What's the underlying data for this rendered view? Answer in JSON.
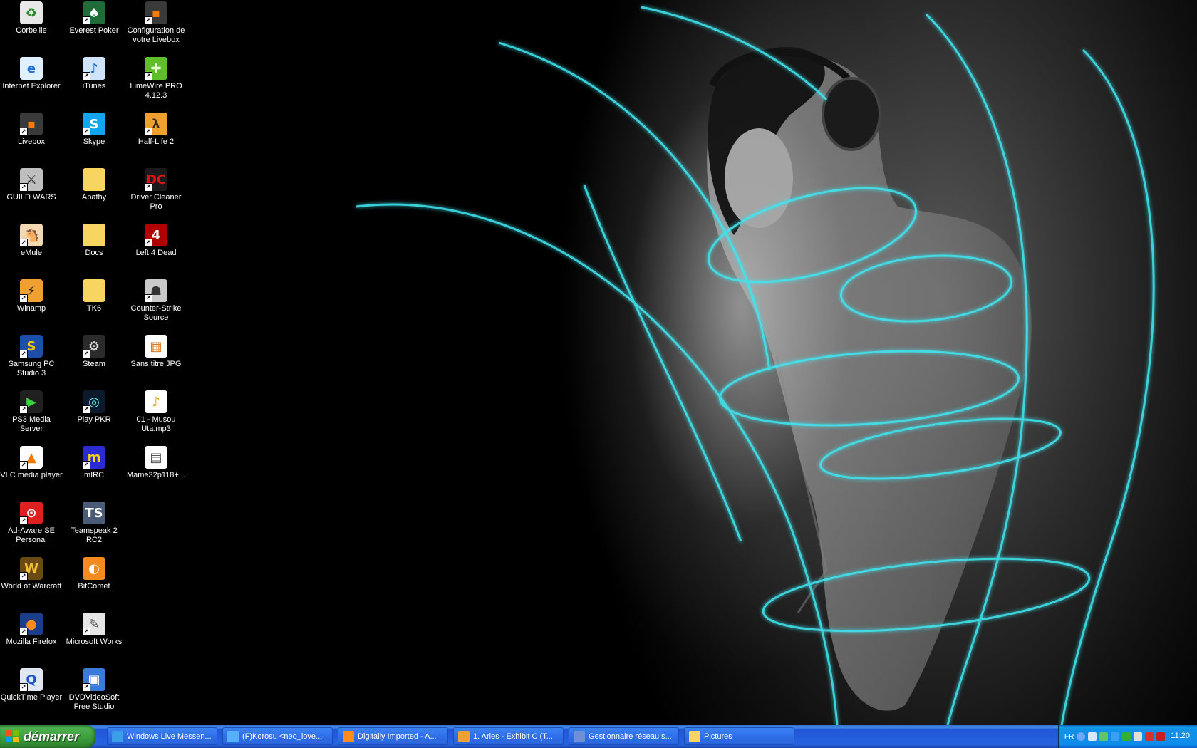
{
  "desktop": {
    "icons": [
      {
        "label": "Corbeille",
        "col": 0,
        "row": 0,
        "glyph": "♻",
        "bg": "#e8e8e8",
        "fg": "#2a8a2a",
        "shortcut": false,
        "name": "recycle-bin-icon"
      },
      {
        "label": "Internet Explorer",
        "col": 0,
        "row": 1,
        "glyph": "e",
        "bg": "#dff0ff",
        "fg": "#1c6ed6",
        "shortcut": false,
        "name": "internet-explorer-icon"
      },
      {
        "label": "Livebox",
        "col": 0,
        "row": 2,
        "glyph": "▪",
        "bg": "#3a3a3a",
        "fg": "#ff7a00",
        "shortcut": true,
        "name": "livebox-icon"
      },
      {
        "label": "GUILD WARS",
        "col": 0,
        "row": 3,
        "glyph": "⚔",
        "bg": "#bfbfbf",
        "fg": "#333",
        "shortcut": true,
        "name": "guild-wars-icon"
      },
      {
        "label": "eMule",
        "col": 0,
        "row": 4,
        "glyph": "🐴",
        "bg": "#f3d9b3",
        "fg": "#8b4513",
        "shortcut": true,
        "name": "emule-icon"
      },
      {
        "label": "Winamp",
        "col": 0,
        "row": 5,
        "glyph": "⚡",
        "bg": "#f0a030",
        "fg": "#222",
        "shortcut": true,
        "name": "winamp-icon"
      },
      {
        "label": "Samsung PC Studio 3",
        "col": 0,
        "row": 6,
        "glyph": "S",
        "bg": "#1d4fa8",
        "fg": "#ffcc00",
        "shortcut": true,
        "name": "samsung-pc-studio-icon"
      },
      {
        "label": "PS3 Media Server",
        "col": 0,
        "row": 7,
        "glyph": "▶",
        "bg": "#202020",
        "fg": "#3ecf3e",
        "shortcut": true,
        "name": "ps3-media-server-icon"
      },
      {
        "label": "VLC media player",
        "col": 0,
        "row": 8,
        "glyph": "▲",
        "bg": "#ffffff",
        "fg": "#f07800",
        "shortcut": true,
        "name": "vlc-icon"
      },
      {
        "label": "Ad-Aware SE Personal",
        "col": 0,
        "row": 9,
        "glyph": "⊙",
        "bg": "#e02020",
        "fg": "#fff",
        "shortcut": true,
        "name": "ad-aware-icon"
      },
      {
        "label": "World of Warcraft",
        "col": 0,
        "row": 10,
        "glyph": "W",
        "bg": "#6b4a14",
        "fg": "#f1c232",
        "shortcut": true,
        "name": "world-of-warcraft-icon"
      },
      {
        "label": "Mozilla Firefox",
        "col": 0,
        "row": 11,
        "glyph": "●",
        "bg": "#1c3e8a",
        "fg": "#ff8c1a",
        "shortcut": true,
        "name": "firefox-icon"
      },
      {
        "label": "QuickTime Player",
        "col": 0,
        "row": 12,
        "glyph": "Q",
        "bg": "#dfe8f3",
        "fg": "#1a56c0",
        "shortcut": true,
        "name": "quicktime-icon"
      },
      {
        "label": "Everest Poker",
        "col": 1,
        "row": 0,
        "glyph": "♠",
        "bg": "#1f6b3a",
        "fg": "#fff",
        "shortcut": true,
        "name": "everest-poker-icon"
      },
      {
        "label": "iTunes",
        "col": 1,
        "row": 1,
        "glyph": "♪",
        "bg": "#cfe4fb",
        "fg": "#1c6ed6",
        "shortcut": true,
        "name": "itunes-icon"
      },
      {
        "label": "Skype",
        "col": 1,
        "row": 2,
        "glyph": "S",
        "bg": "#12a5f0",
        "fg": "#fff",
        "shortcut": true,
        "name": "skype-icon"
      },
      {
        "label": "Apathy",
        "col": 1,
        "row": 3,
        "glyph": "",
        "bg": "#f7d560",
        "fg": "#c9a227",
        "shortcut": false,
        "name": "folder-icon"
      },
      {
        "label": "Docs",
        "col": 1,
        "row": 4,
        "glyph": "",
        "bg": "#f7d560",
        "fg": "#c9a227",
        "shortcut": false,
        "name": "folder-icon"
      },
      {
        "label": "TK6",
        "col": 1,
        "row": 5,
        "glyph": "",
        "bg": "#f7d560",
        "fg": "#c9a227",
        "shortcut": false,
        "name": "folder-icon"
      },
      {
        "label": "Steam",
        "col": 1,
        "row": 6,
        "glyph": "⚙",
        "bg": "#2b2b2b",
        "fg": "#ddd",
        "shortcut": true,
        "name": "steam-icon"
      },
      {
        "label": "Play PKR",
        "col": 1,
        "row": 7,
        "glyph": "◎",
        "bg": "#0b1b2b",
        "fg": "#6ee7ff",
        "shortcut": true,
        "name": "play-pkr-icon"
      },
      {
        "label": "mIRC",
        "col": 1,
        "row": 8,
        "glyph": "m",
        "bg": "#2b2bd6",
        "fg": "#ffd700",
        "shortcut": true,
        "name": "mirc-icon"
      },
      {
        "label": "Teamspeak 2 RC2",
        "col": 1,
        "row": 9,
        "glyph": "TS",
        "bg": "#4a5b78",
        "fg": "#fff",
        "shortcut": false,
        "name": "teamspeak-icon"
      },
      {
        "label": "BitComet",
        "col": 1,
        "row": 10,
        "glyph": "◐",
        "bg": "#f58a1f",
        "fg": "#fff",
        "shortcut": false,
        "name": "bitcomet-icon"
      },
      {
        "label": "Microsoft Works",
        "col": 1,
        "row": 11,
        "glyph": "✎",
        "bg": "#e6e6e6",
        "fg": "#555",
        "shortcut": true,
        "name": "microsoft-works-icon"
      },
      {
        "label": "DVDVideoSoft Free Studio",
        "col": 1,
        "row": 12,
        "glyph": "▣",
        "bg": "#3a7ad9",
        "fg": "#fff",
        "shortcut": true,
        "name": "dvdvideosoft-icon"
      },
      {
        "label": "Configuration de votre Livebox",
        "col": 2,
        "row": 0,
        "glyph": "▪",
        "bg": "#3a3a3a",
        "fg": "#ff7a00",
        "shortcut": true,
        "name": "livebox-config-icon"
      },
      {
        "label": "LimeWire PRO 4.12.3",
        "col": 2,
        "row": 1,
        "glyph": "✚",
        "bg": "#5fbf2a",
        "fg": "#e7ffd0",
        "shortcut": true,
        "name": "limewire-icon"
      },
      {
        "label": "Half-Life 2",
        "col": 2,
        "row": 2,
        "glyph": "λ",
        "bg": "#f0a030",
        "fg": "#3b2a10",
        "shortcut": true,
        "name": "half-life-2-icon"
      },
      {
        "label": "Driver Cleaner Pro",
        "col": 2,
        "row": 3,
        "glyph": "DC",
        "bg": "#1a1a1a",
        "fg": "#e01010",
        "shortcut": true,
        "name": "driver-cleaner-icon"
      },
      {
        "label": "Left 4 Dead",
        "col": 2,
        "row": 4,
        "glyph": "4",
        "bg": "#b00000",
        "fg": "#fff",
        "shortcut": true,
        "name": "left-4-dead-icon"
      },
      {
        "label": "Counter-Strike Source",
        "col": 2,
        "row": 5,
        "glyph": "☗",
        "bg": "#c9c9c9",
        "fg": "#333",
        "shortcut": true,
        "name": "counter-strike-icon"
      },
      {
        "label": "Sans titre.JPG",
        "col": 2,
        "row": 6,
        "glyph": "▦",
        "bg": "#ffffff",
        "fg": "#e0771a",
        "shortcut": false,
        "name": "image-file-icon"
      },
      {
        "label": "01 - Musou Uta.mp3",
        "col": 2,
        "row": 7,
        "glyph": "♪",
        "bg": "#ffffff",
        "fg": "#d4a017",
        "shortcut": false,
        "name": "audio-file-icon"
      },
      {
        "label": "Mame32p118+...",
        "col": 2,
        "row": 8,
        "glyph": "▤",
        "bg": "#ffffff",
        "fg": "#555",
        "shortcut": false,
        "name": "file-icon"
      }
    ]
  },
  "taskbar": {
    "start_label": "démarrer",
    "tasks": [
      {
        "label": "Windows Live Messen...",
        "color": "#3a9ee8"
      },
      {
        "label": "(F)Korosu <neo_love...",
        "color": "#56b0ff"
      },
      {
        "label": "Digitally Imported - A...",
        "color": "#ff8c1a"
      },
      {
        "label": "1. Aries - Exhibit C (T...",
        "color": "#f0a030"
      },
      {
        "label": "Gestionnaire réseau s...",
        "color": "#6f8fd8"
      },
      {
        "label": "Pictures",
        "color": "#f7d560"
      }
    ],
    "tray": {
      "language": "FR",
      "clock": "11:20"
    }
  }
}
